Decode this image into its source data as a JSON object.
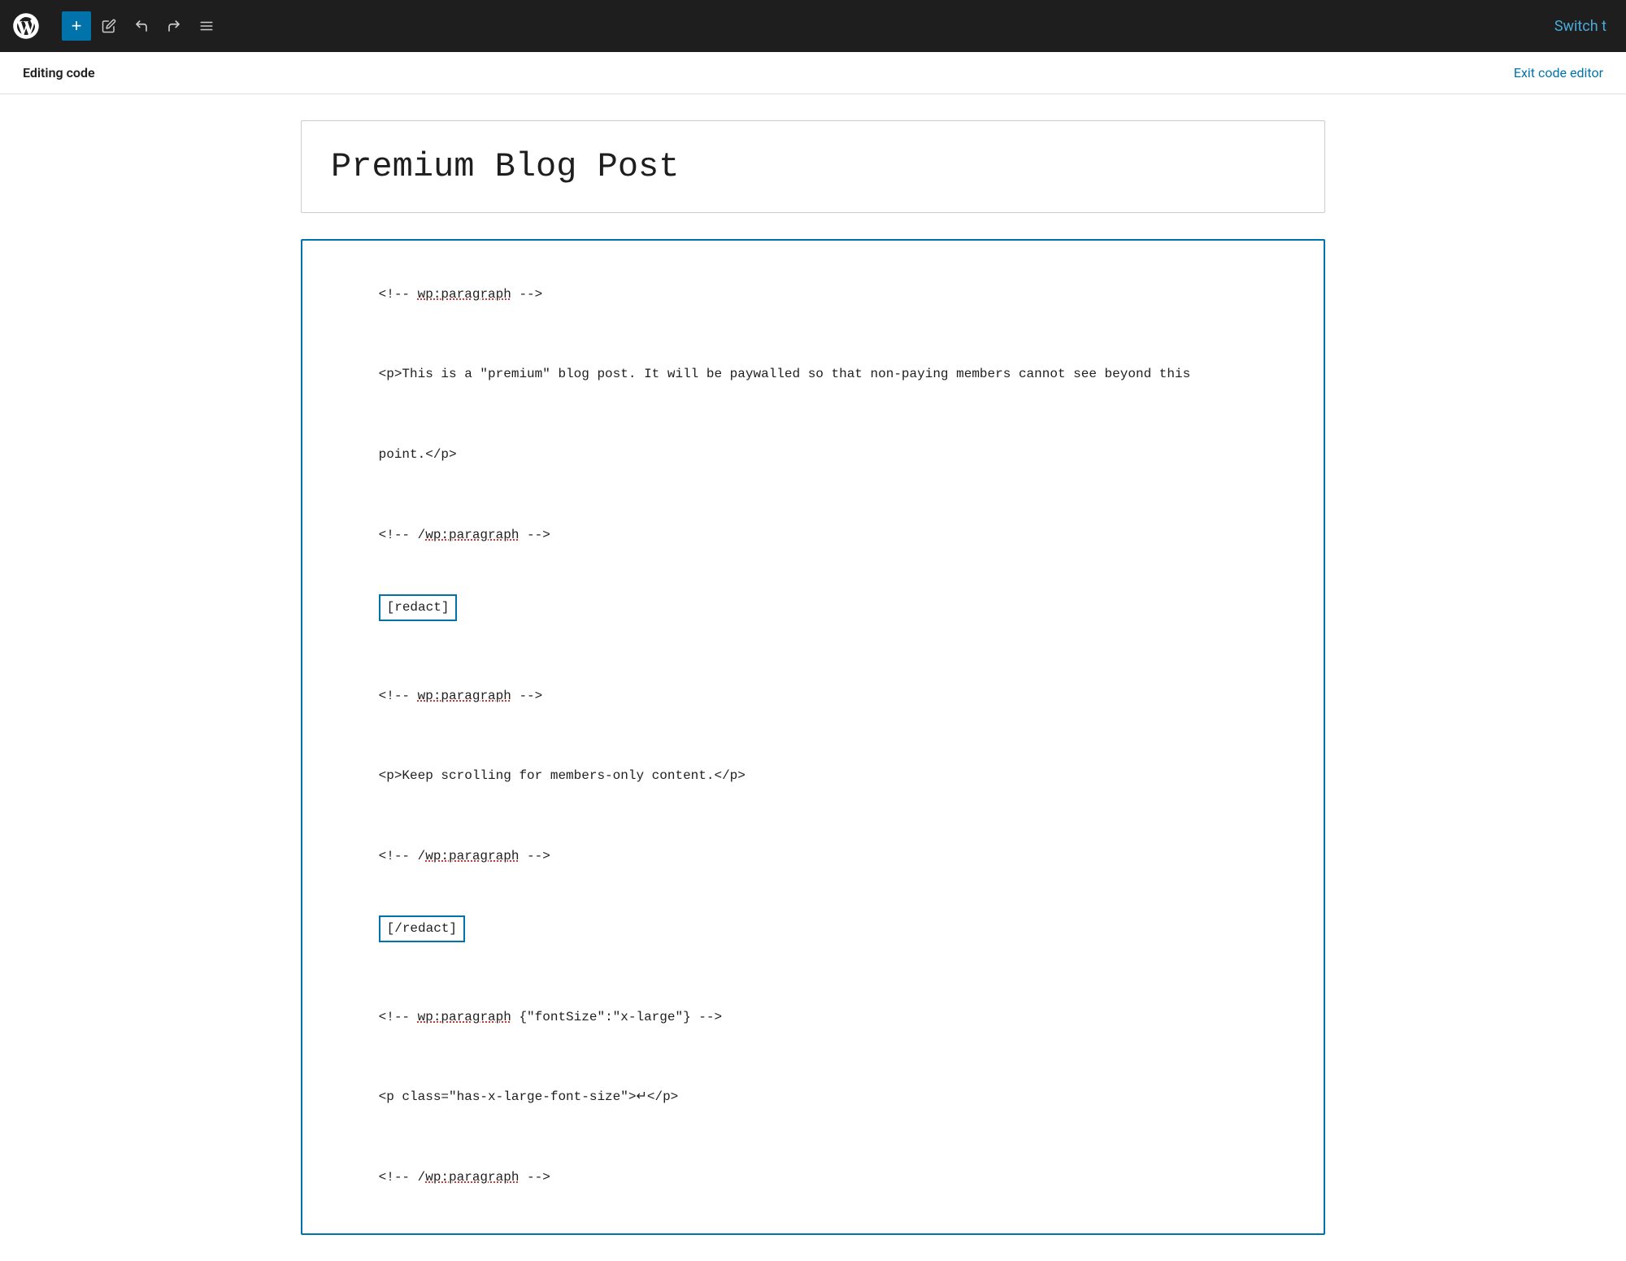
{
  "toolbar": {
    "wp_logo_alt": "WordPress",
    "add_button_label": "+",
    "switch_label": "Switch t"
  },
  "subheader": {
    "editing_code_label": "Editing code",
    "exit_button_label": "Exit code editor"
  },
  "editor": {
    "post_title": "Premium Blog Post",
    "code_lines": [
      {
        "type": "comment",
        "text": "<!-- ",
        "tag": "wp:paragraph",
        "end": " -->"
      },
      {
        "type": "blank"
      },
      {
        "type": "code",
        "text": "<p>This is a \"premium\" blog post. It will be paywalled so that non-paying members cannot see beyond this"
      },
      {
        "type": "blank"
      },
      {
        "type": "code",
        "text": "point.</p>"
      },
      {
        "type": "blank"
      },
      {
        "type": "comment_close",
        "text": "<!-- /",
        "tag": "wp:paragraph",
        "end": " -->"
      },
      {
        "type": "shortcode",
        "text": "[redact]"
      },
      {
        "type": "blank"
      },
      {
        "type": "comment",
        "text": "<!-- ",
        "tag": "wp:paragraph",
        "end": " -->"
      },
      {
        "type": "blank"
      },
      {
        "type": "code",
        "text": "<p>Keep scrolling for members-only content.</p>"
      },
      {
        "type": "blank"
      },
      {
        "type": "comment_close",
        "text": "<!-- /",
        "tag": "wp:paragraph",
        "end": " -->"
      },
      {
        "type": "shortcode",
        "text": "[/redact]"
      },
      {
        "type": "blank"
      },
      {
        "type": "comment_attrs",
        "text": "<!-- ",
        "tag": "wp:paragraph",
        "attrs": " {\"fontSize\":\"x-large\"}",
        "end": " -->"
      },
      {
        "type": "blank"
      },
      {
        "type": "code_arrow",
        "text": "<p class=\"has-x-large-font-size\">↵</p>"
      },
      {
        "type": "blank"
      },
      {
        "type": "comment_close",
        "text": "<!-- /",
        "tag": "wp:paragraph",
        "end": " -->"
      }
    ]
  }
}
